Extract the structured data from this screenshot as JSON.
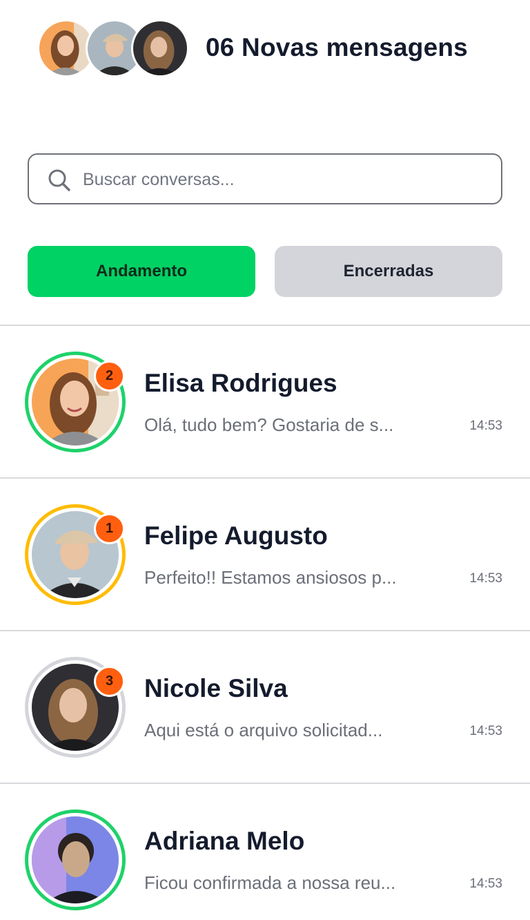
{
  "header": {
    "title": "06 Novas mensagens",
    "avatars": [
      "avatar-woman-1",
      "avatar-man-1",
      "avatar-woman-2"
    ]
  },
  "search": {
    "placeholder": "Buscar conversas...",
    "value": "",
    "icon": "search-icon"
  },
  "tabs": [
    {
      "label": "Andamento",
      "active": true
    },
    {
      "label": "Encerradas",
      "active": false
    }
  ],
  "colors": {
    "accent": "#00d264",
    "tab_inactive": "#d3d5da",
    "badge": "#ff5f0f",
    "ring_green": "#1ed26a",
    "ring_yellow": "#ffbc05",
    "ring_gray": "#d3d5da"
  },
  "conversations": [
    {
      "name": "Elisa Rodrigues",
      "preview": "Olá, tudo bem? Gostaria de s...",
      "time": "14:53",
      "unread": "2",
      "ring": "#1ed26a"
    },
    {
      "name": "Felipe Augusto",
      "preview": "Perfeito!! Estamos ansiosos p...",
      "time": "14:53",
      "unread": "1",
      "ring": "#ffbc05"
    },
    {
      "name": "Nicole Silva",
      "preview": "Aqui está o arquivo solicitad...",
      "time": "14:53",
      "unread": "3",
      "ring": "#d3d5da"
    },
    {
      "name": "Adriana Melo",
      "preview": "Ficou confirmada a nossa reu...",
      "time": "14:53",
      "unread": "",
      "ring": "#1ed26a"
    }
  ]
}
